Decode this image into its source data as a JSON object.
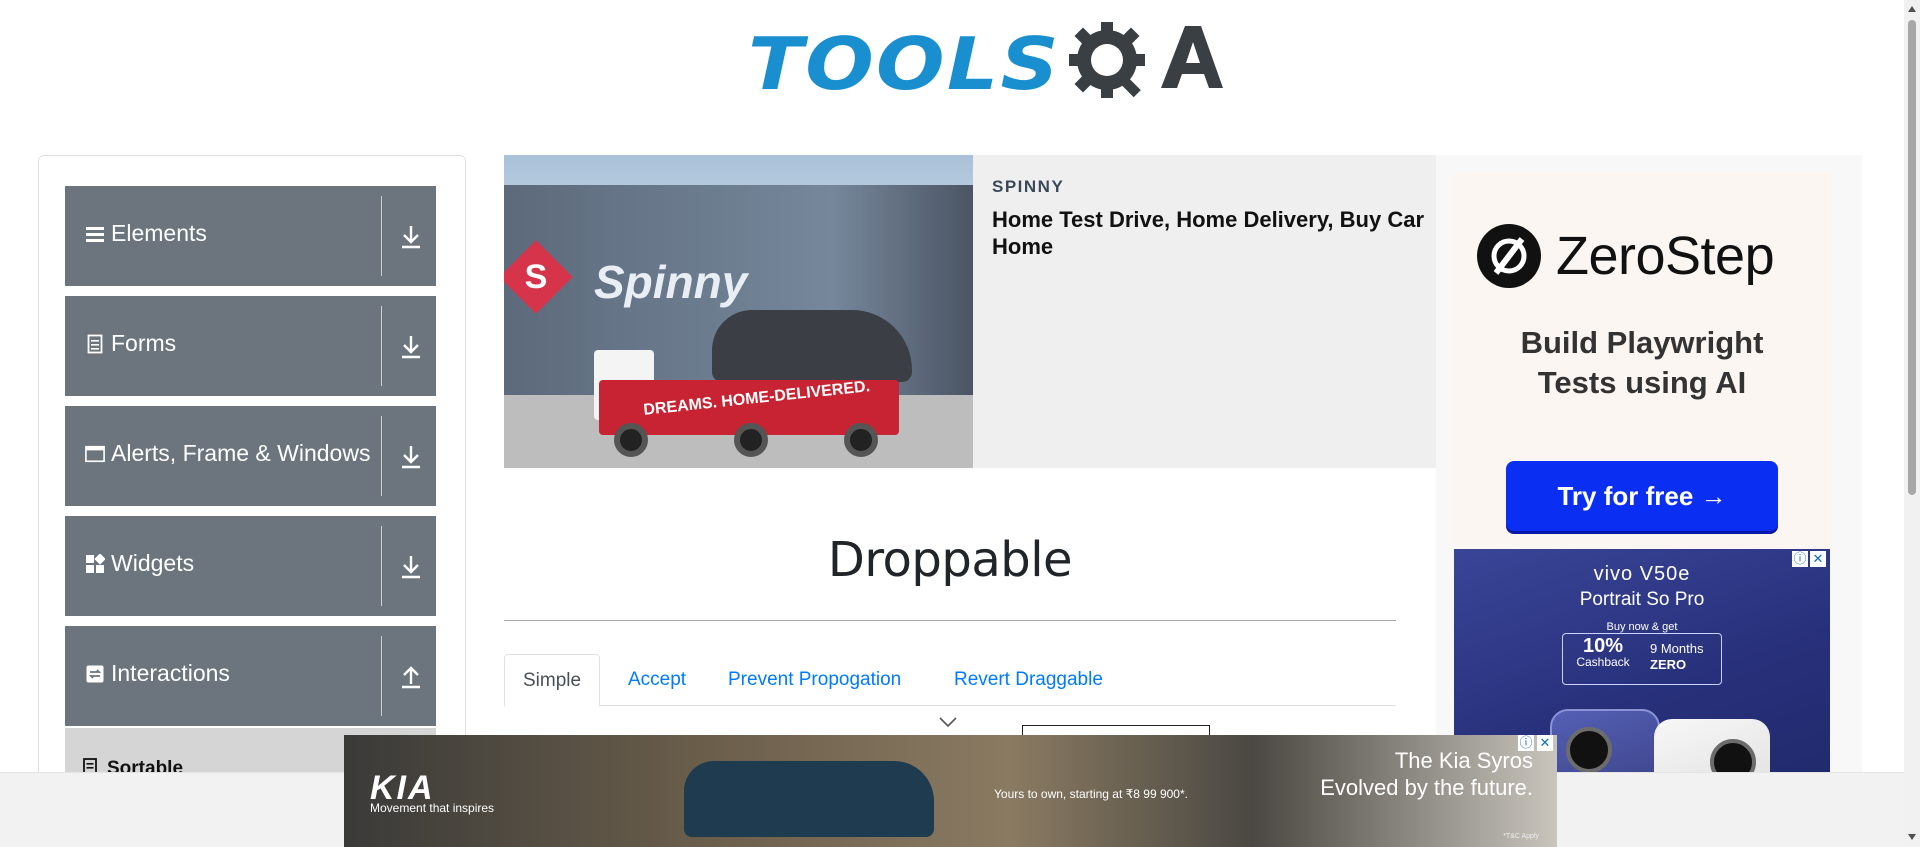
{
  "header": {
    "logo_text": "TOOLS",
    "logo_suffix": "QA"
  },
  "sidebar": {
    "groups": [
      {
        "label": "Elements",
        "icon": "hamburger-icon",
        "arrow": "download-arrow-icon"
      },
      {
        "label": "Forms",
        "icon": "document-icon",
        "arrow": "download-arrow-icon"
      },
      {
        "label": "Alerts, Frame & Windows",
        "icon": "window-icon",
        "arrow": "download-arrow-icon"
      },
      {
        "label": "Widgets",
        "icon": "widgets-icon",
        "arrow": "download-arrow-icon"
      },
      {
        "label": "Interactions",
        "icon": "interactions-icon",
        "arrow": "upload-arrow-icon"
      }
    ],
    "sub_items": [
      {
        "label": "Sortable"
      }
    ]
  },
  "ad_top": {
    "brand_on_image": "Spinny",
    "truck_text": "DREAMS. HOME-DELIVERED.",
    "sponsor": "SPINNY",
    "headline": "Home Test Drive, Home Delivery, Buy Car Home"
  },
  "ad_right": {
    "zerostep": {
      "brand": "ZeroStep",
      "tagline_1": "Build Playwright",
      "tagline_2": "Tests using AI",
      "cta": "Try for free →"
    },
    "vivo": {
      "brand": "vivo V50e",
      "subtitle": "Portrait So Pro",
      "buy_now": "Buy now & get",
      "cashback_pct": "10%",
      "cashback": "Cashback",
      "months": "9 Months",
      "zero": "ZERO"
    }
  },
  "main": {
    "title": "Droppable",
    "tabs": [
      {
        "label": "Simple",
        "active": true
      },
      {
        "label": "Accept",
        "active": false
      },
      {
        "label": "Prevent Propogation",
        "active": false
      },
      {
        "label": "Revert Draggable",
        "active": false
      }
    ]
  },
  "ad_bottom": {
    "brand": "KIA",
    "motto": "Movement that inspires",
    "price_text": "Yours to own, starting at ₹8 99 900*.",
    "headline_1": "The Kia Syros",
    "headline_2": "Evolved by the future.",
    "tc": "*T&C Apply"
  },
  "colors": {
    "accent": "#007bff",
    "sidebar_bg": "#6c757d",
    "logo_blue": "#1a8fd0",
    "zerostep_cta": "#0b2ff2"
  }
}
